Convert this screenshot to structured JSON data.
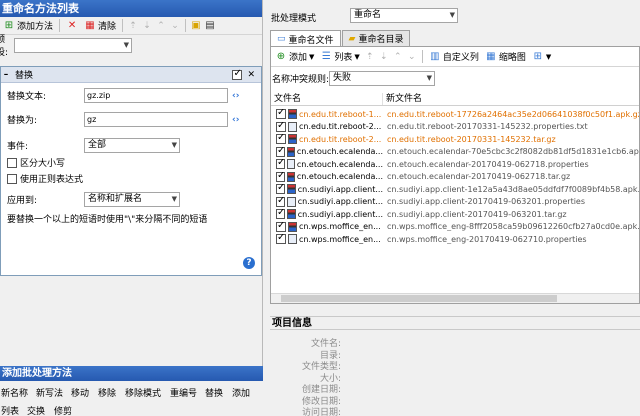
{
  "left": {
    "title": "重命名方法列表",
    "toolbar": {
      "add": "添加方法",
      "clear": "清除"
    },
    "preset_label": "预设:",
    "preset_value": "",
    "method": {
      "name": "替换",
      "find_label": "替换文本:",
      "find_value": "gz.zip",
      "replace_label": "替换为:",
      "replace_value": "gz",
      "occurrence_label": "事件:",
      "occurrence_value": "全部",
      "case_sensitive": "区分大小写",
      "regex": "使用正则表达式",
      "apply_to_label": "应用到:",
      "apply_to_value": "名称和扩展名",
      "hint": "要替换一个以上的短语时使用\"\\\"来分隔不同的短语"
    },
    "add_methods": {
      "title": "添加批处理方法",
      "items": [
        "新名称",
        "新写法",
        "移动",
        "移除",
        "移除模式",
        "重编号",
        "替换",
        "添加",
        "列表",
        "交换",
        "修剪"
      ]
    }
  },
  "right": {
    "batch_mode_label": "批处理模式",
    "batch_mode_value": "重命名",
    "tabs": [
      "重命名文件",
      "重命名目录"
    ],
    "toolbar": {
      "add": "添加",
      "list": "列表",
      "custom_columns": "自定义列",
      "thumbnails": "缩略图"
    },
    "conflict_label": "名称冲突规则:",
    "conflict_value": "失败",
    "columns": [
      "文件名",
      "新文件名"
    ],
    "files": [
      {
        "name": "cn.edu.tit.reboot-1...",
        "new": "cn.edu.tit.reboot-17726a2464ac35e2d06641038f0c50f1.apk.gz",
        "highlight": true,
        "icon": "rar"
      },
      {
        "name": "cn.edu.tit.reboot-2...",
        "new": "cn.edu.tit.reboot-20170331-145232.properties.txt",
        "highlight": false,
        "icon": "doc"
      },
      {
        "name": "cn.edu.tit.reboot-2...",
        "new": "cn.edu.tit.reboot-20170331-145232.tar.gz",
        "highlight": true,
        "icon": "rar"
      },
      {
        "name": "cn.etouch.ecalenda...",
        "new": "cn.etouch.ecalendar-70e5cbc3c2f8082db81df5d1831e1cb6.apk.gz",
        "highlight": false,
        "icon": "rar"
      },
      {
        "name": "cn.etouch.ecalenda...",
        "new": "cn.etouch.ecalendar-20170419-062718.properties",
        "highlight": false,
        "icon": "doc"
      },
      {
        "name": "cn.etouch.ecalenda...",
        "new": "cn.etouch.ecalendar-20170419-062718.tar.gz",
        "highlight": false,
        "icon": "rar"
      },
      {
        "name": "cn.sudiyi.app.client...",
        "new": "cn.sudiyi.app.client-1e12a5a43d8ae05ddfdf7f0089bf4b58.apk.gz",
        "highlight": false,
        "icon": "rar"
      },
      {
        "name": "cn.sudiyi.app.client...",
        "new": "cn.sudiyi.app.client-20170419-063201.properties",
        "highlight": false,
        "icon": "doc"
      },
      {
        "name": "cn.sudiyi.app.client...",
        "new": "cn.sudiyi.app.client-20170419-063201.tar.gz",
        "highlight": false,
        "icon": "rar"
      },
      {
        "name": "cn.wps.moffice_en...",
        "new": "cn.wps.moffice_eng-8fff2058ca59b09612260cfb27a0cd0e.apk.gz",
        "highlight": false,
        "icon": "rar"
      },
      {
        "name": "cn.wps.moffice_en...",
        "new": "cn.wps.moffice_eng-20170419-062710.properties",
        "highlight": false,
        "icon": "doc"
      }
    ],
    "info": {
      "title": "项目信息",
      "labels": [
        "文件名:",
        "目录:",
        "文件类型:",
        "大小:",
        "创建日期:",
        "修改日期:",
        "访问日期:"
      ]
    }
  }
}
